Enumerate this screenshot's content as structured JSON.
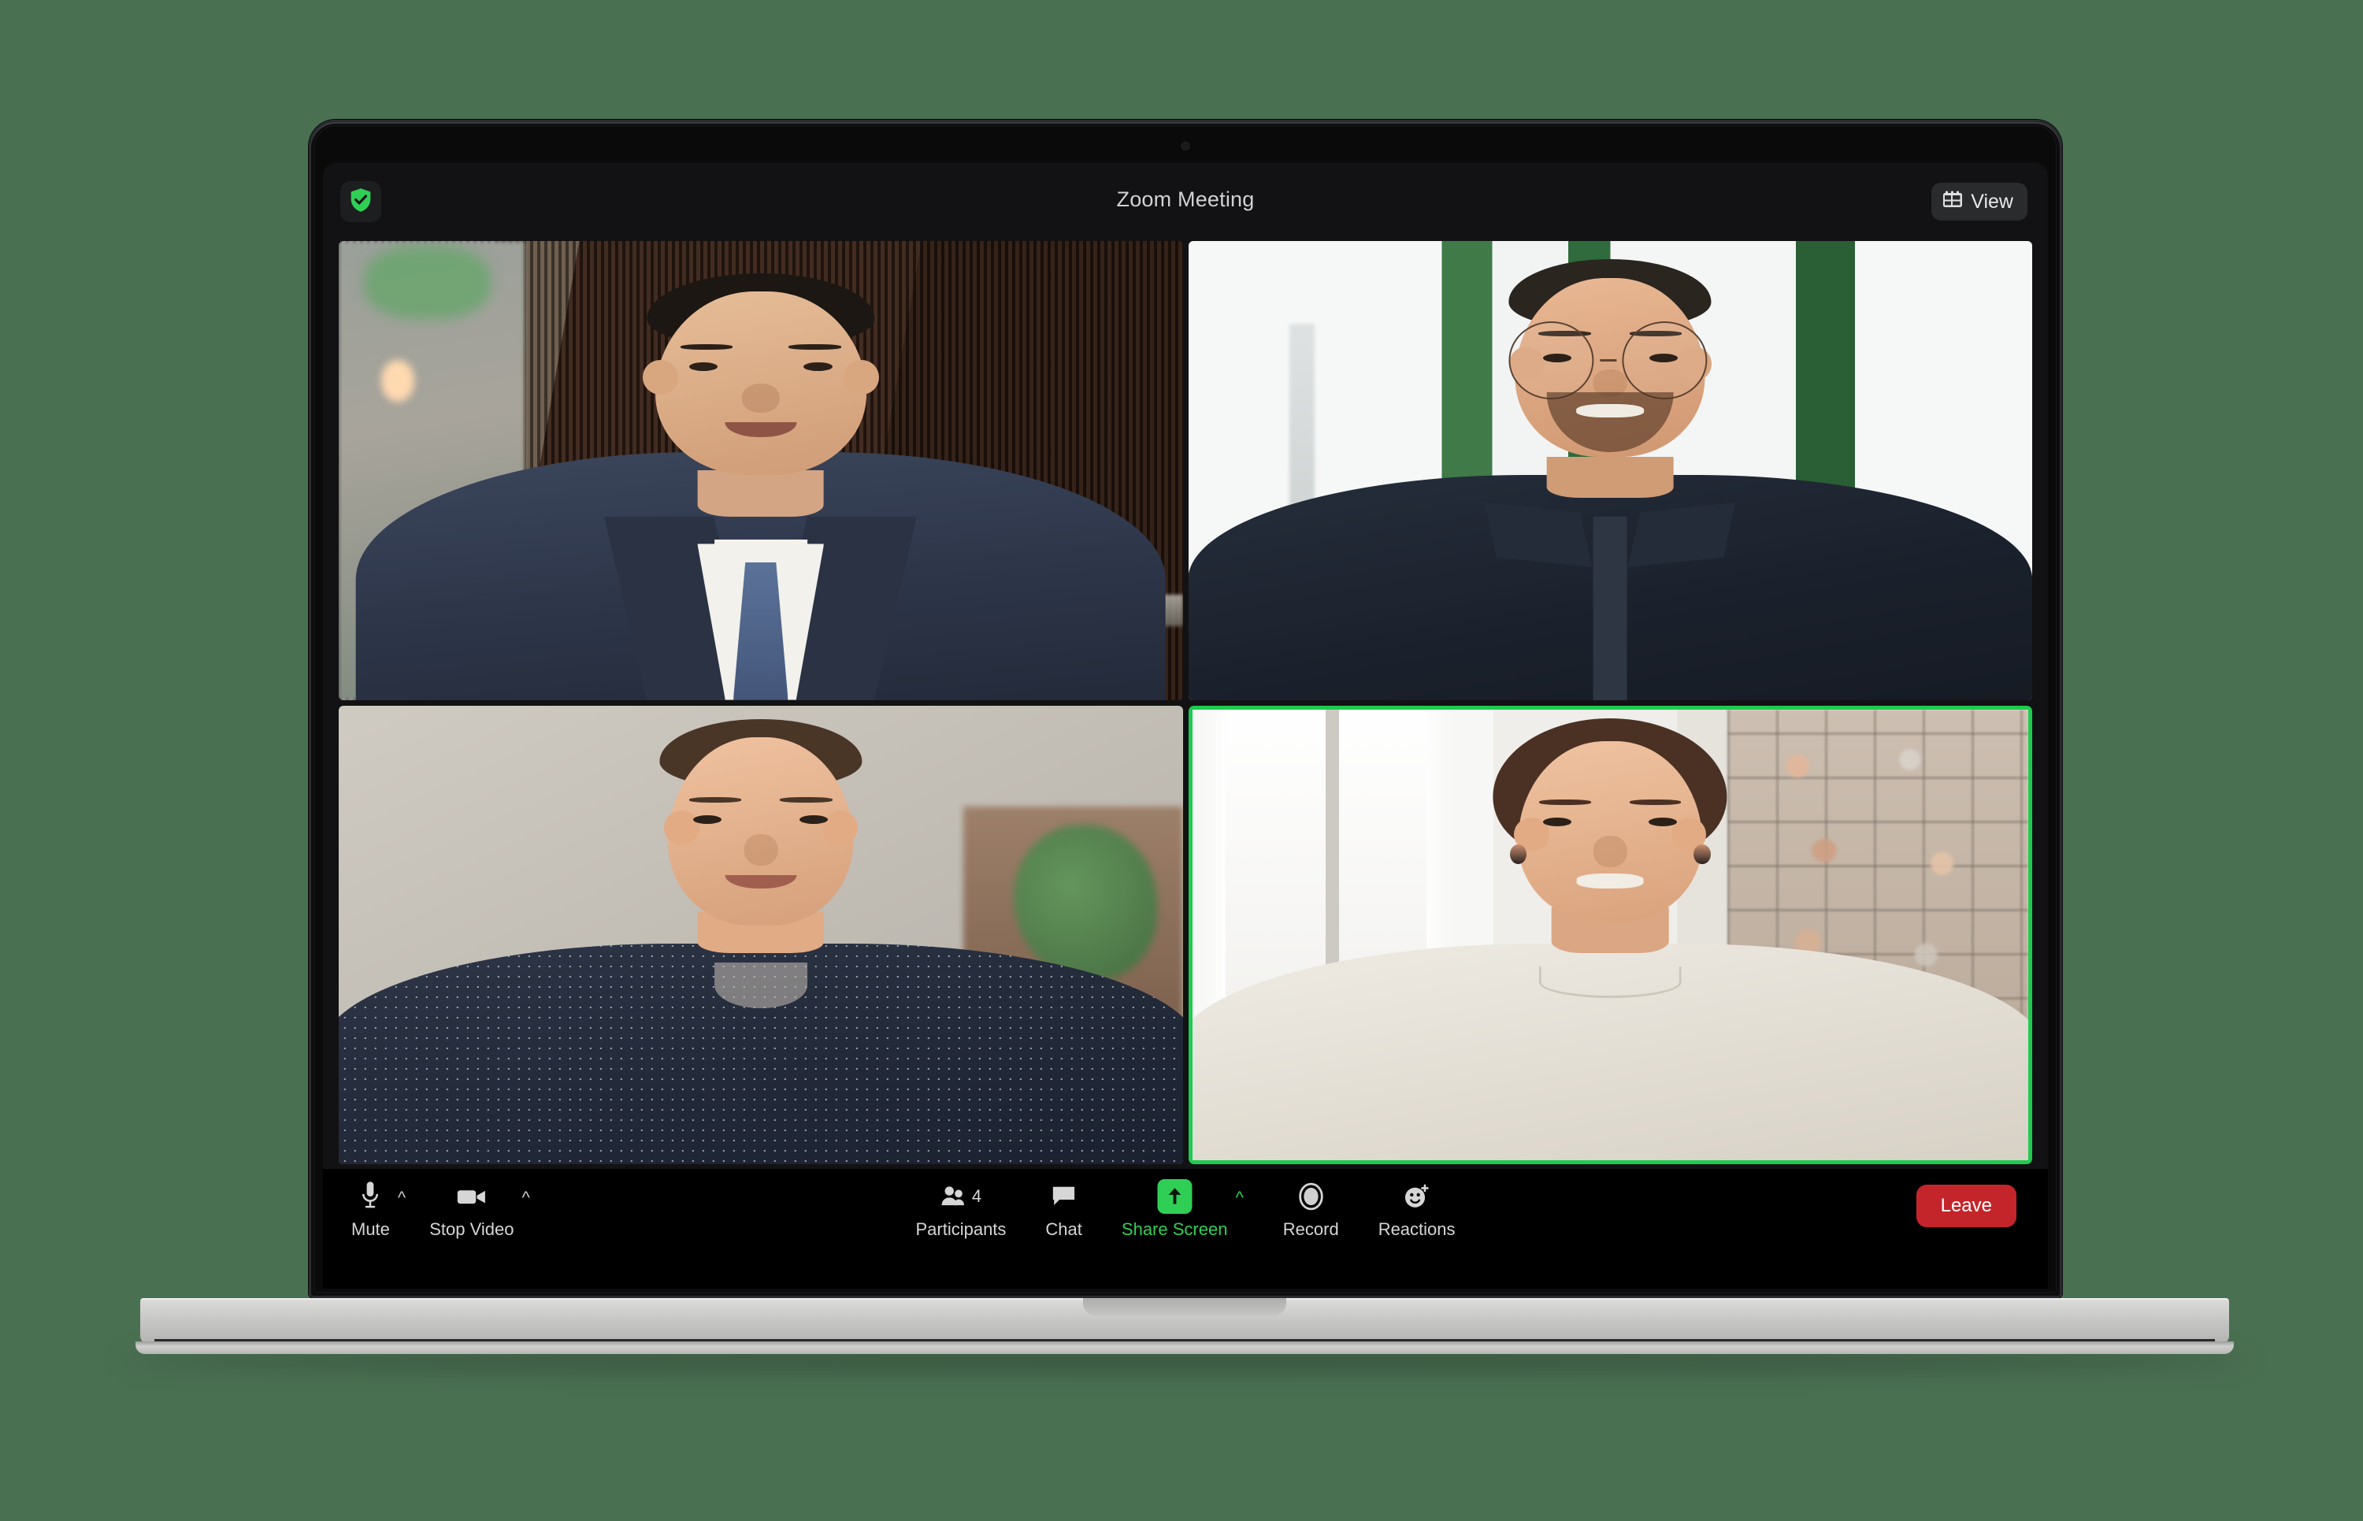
{
  "background": {
    "color": "#4a7052"
  },
  "device": {
    "name": "laptop",
    "base_color": "#c9c9c7",
    "bezel_color": "#0d0d0f"
  },
  "app": {
    "name": "Zoom",
    "title": "Zoom Meeting",
    "titlebar": {
      "encryption_icon": "shield-check-icon",
      "encryption_color": "#2fcf56",
      "view_button": {
        "label": "View",
        "icon": "grid-layout-icon"
      }
    },
    "accent_color": "#2fcf56",
    "leave_color": "#c4252a"
  },
  "gallery": {
    "layout": "2x2-grid",
    "active_speaker_border_color": "#1ecb4f",
    "tiles": [
      {
        "id": "tile-1",
        "position": "top-left",
        "active_speaker": false,
        "description": "man-in-navy-suit"
      },
      {
        "id": "tile-2",
        "position": "top-right",
        "active_speaker": false,
        "description": "man-with-glasses-dark-shirt"
      },
      {
        "id": "tile-3",
        "position": "bottom-left",
        "active_speaker": false,
        "description": "man-in-polka-dot-shirt"
      },
      {
        "id": "tile-4",
        "position": "bottom-right",
        "active_speaker": true,
        "description": "woman-in-cream-top"
      }
    ]
  },
  "toolbar": {
    "left": [
      {
        "id": "mute",
        "label": "Mute",
        "icon": "microphone-icon",
        "caret": "^",
        "has_caret": true
      },
      {
        "id": "stop-video",
        "label": "Stop Video",
        "icon": "video-camera-icon",
        "caret": "^",
        "has_caret": true
      }
    ],
    "center": [
      {
        "id": "participants",
        "label": "Participants",
        "icon": "people-icon",
        "count": "4",
        "has_caret": false
      },
      {
        "id": "chat",
        "label": "Chat",
        "icon": "chat-bubble-icon",
        "has_caret": false
      },
      {
        "id": "share-screen",
        "label": "Share Screen",
        "icon": "share-arrow-up-icon",
        "caret": "^",
        "has_caret": true,
        "accent": true
      },
      {
        "id": "record",
        "label": "Record",
        "icon": "record-circle-icon",
        "has_caret": false
      },
      {
        "id": "reactions",
        "label": "Reactions",
        "icon": "smiley-plus-icon",
        "has_caret": false
      }
    ],
    "right": {
      "id": "leave",
      "label": "Leave"
    }
  }
}
